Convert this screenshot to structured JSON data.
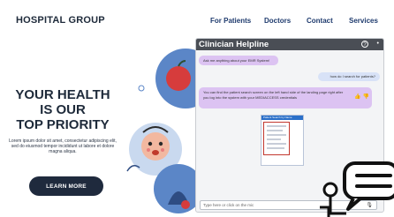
{
  "header": {
    "brand": "HOSPITAL GROUP",
    "nav": [
      "For Patients",
      "Doctors",
      "Contact",
      "Services"
    ]
  },
  "hero": {
    "title_lines": [
      "YOUR HEALTH",
      "IS OUR",
      "TOP PRIORITY"
    ],
    "body": "Lorem ipsum dolor sit amet, consectetur adipiscing elit, sed do eiusmod tempor incididunt ut labore et dolore magna aliqua.",
    "button": "LEARN MORE"
  },
  "chat": {
    "title": "Clinician Helpline",
    "help_icon": "?",
    "menu_icon": "•",
    "messages": [
      {
        "from": "bot",
        "text": "Ask me anything about your EMR System!"
      },
      {
        "from": "user",
        "text": "how do I search for patients?"
      },
      {
        "from": "bot",
        "text": "You can find the patient search screen on the left hand side of the landing page right after you log into the system with your MEDIACCESS credentials"
      }
    ],
    "feedback_icons": "👍 👎",
    "screenshot_title": "Patient Search by Name",
    "input_placeholder": "Type here or click on the mic",
    "mic_icon": "🎙"
  },
  "colors": {
    "brand_dark": "#1e2a3a",
    "nav_blue": "#1f3b6e",
    "bot_bubble": "#dcc3f2",
    "user_bubble": "#d8e2f7",
    "chat_header": "#4a4e55",
    "button_dark": "#1f2a3d"
  }
}
